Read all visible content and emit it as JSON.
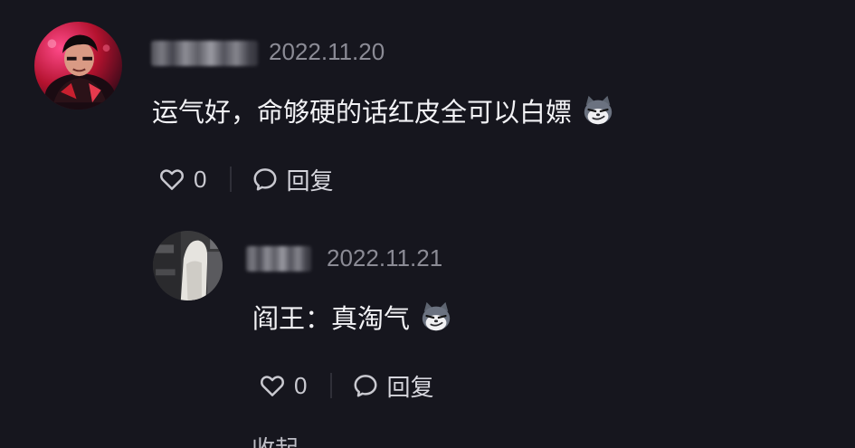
{
  "comment": {
    "timestamp": "2022.11.20",
    "text": "运气好，命够硬的话红皮全可以白嫖",
    "emoji_icon": "smirk-cat-emoji",
    "like_count": "0",
    "reply_label": "回复"
  },
  "reply": {
    "timestamp": "2022.11.21",
    "text": "阎王：真淘气",
    "emoji_icon": "smirk-cat-emoji",
    "like_count": "0",
    "reply_label": "回复"
  },
  "next_item_partial_text": "收起",
  "colors": {
    "background": "#16161e",
    "text_primary": "#f2f2f5",
    "text_secondary": "#8b8b95",
    "action_icon": "#c9c9d0"
  }
}
